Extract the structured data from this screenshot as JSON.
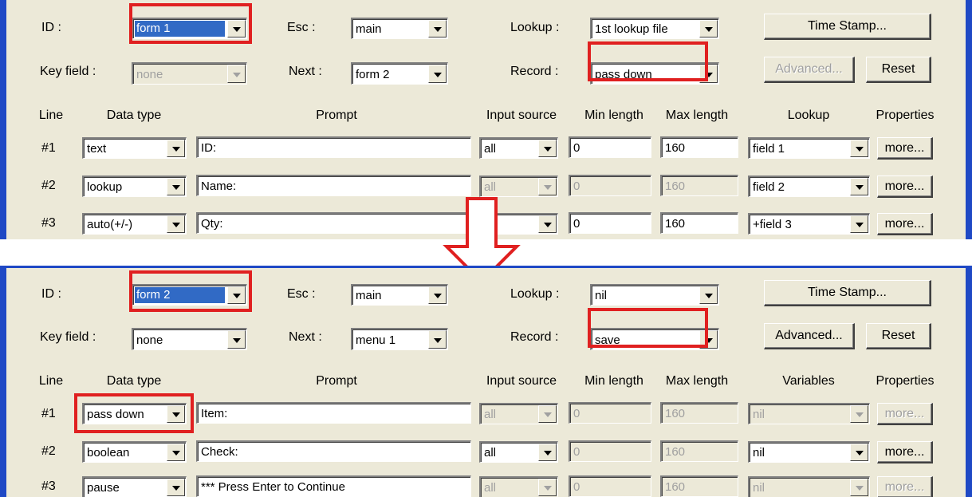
{
  "top": {
    "id_label": "ID :",
    "id_value": "form 1",
    "esc_label": "Esc :",
    "esc_value": "main",
    "lookup_label": "Lookup :",
    "lookup_value": "1st lookup file",
    "timestamp_label": "Time Stamp...",
    "keyfield_label": "Key field :",
    "keyfield_value": "none",
    "next_label": "Next :",
    "next_value": "form 2",
    "record_label": "Record :",
    "record_value": "pass down",
    "advanced_label": "Advanced...",
    "reset_label": "Reset",
    "headers": [
      "Line",
      "Data type",
      "Prompt",
      "Input source",
      "Min length",
      "Max length",
      "Lookup",
      "Properties"
    ],
    "rows": [
      {
        "line": "#1",
        "type": "text",
        "prompt": "ID:",
        "source": "all",
        "min": "0",
        "max": "160",
        "lookup": "field 1",
        "more": "more..."
      },
      {
        "line": "#2",
        "type": "lookup",
        "prompt": "Name:",
        "source": "all",
        "min": "0",
        "max": "160",
        "lookup": "field 2",
        "more": "more..."
      },
      {
        "line": "#3",
        "type": "auto(+/-)",
        "prompt": "Qty:",
        "source": "",
        "min": "0",
        "max": "160",
        "lookup": "+field 3",
        "more": "more..."
      }
    ]
  },
  "bottom": {
    "id_label": "ID :",
    "id_value": "form 2",
    "esc_label": "Esc :",
    "esc_value": "main",
    "lookup_label": "Lookup :",
    "lookup_value": "nil",
    "timestamp_label": "Time Stamp...",
    "keyfield_label": "Key field :",
    "keyfield_value": "none",
    "next_label": "Next :",
    "next_value": "menu 1",
    "record_label": "Record :",
    "record_value": "save",
    "advanced_label": "Advanced...",
    "reset_label": "Reset",
    "headers": [
      "Line",
      "Data type",
      "Prompt",
      "Input source",
      "Min length",
      "Max length",
      "Variables",
      "Properties"
    ],
    "rows": [
      {
        "line": "#1",
        "type": "pass down",
        "prompt": "Item:",
        "source": "all",
        "min": "0",
        "max": "160",
        "lookup": "nil",
        "more": "more..."
      },
      {
        "line": "#2",
        "type": "boolean",
        "prompt": "Check:",
        "source": "all",
        "min": "0",
        "max": "160",
        "lookup": "nil",
        "more": "more..."
      },
      {
        "line": "#3",
        "type": "pause",
        "prompt": "*** Press Enter to Continue",
        "source": "all",
        "min": "0",
        "max": "160",
        "lookup": "nil",
        "more": "more..."
      }
    ]
  },
  "colors": {
    "highlight": "#e02020",
    "window_border": "#1f49c5",
    "selection": "#316ac5",
    "dialog_bg": "#ece9d8"
  },
  "arrow_icon": "down-arrow-icon"
}
